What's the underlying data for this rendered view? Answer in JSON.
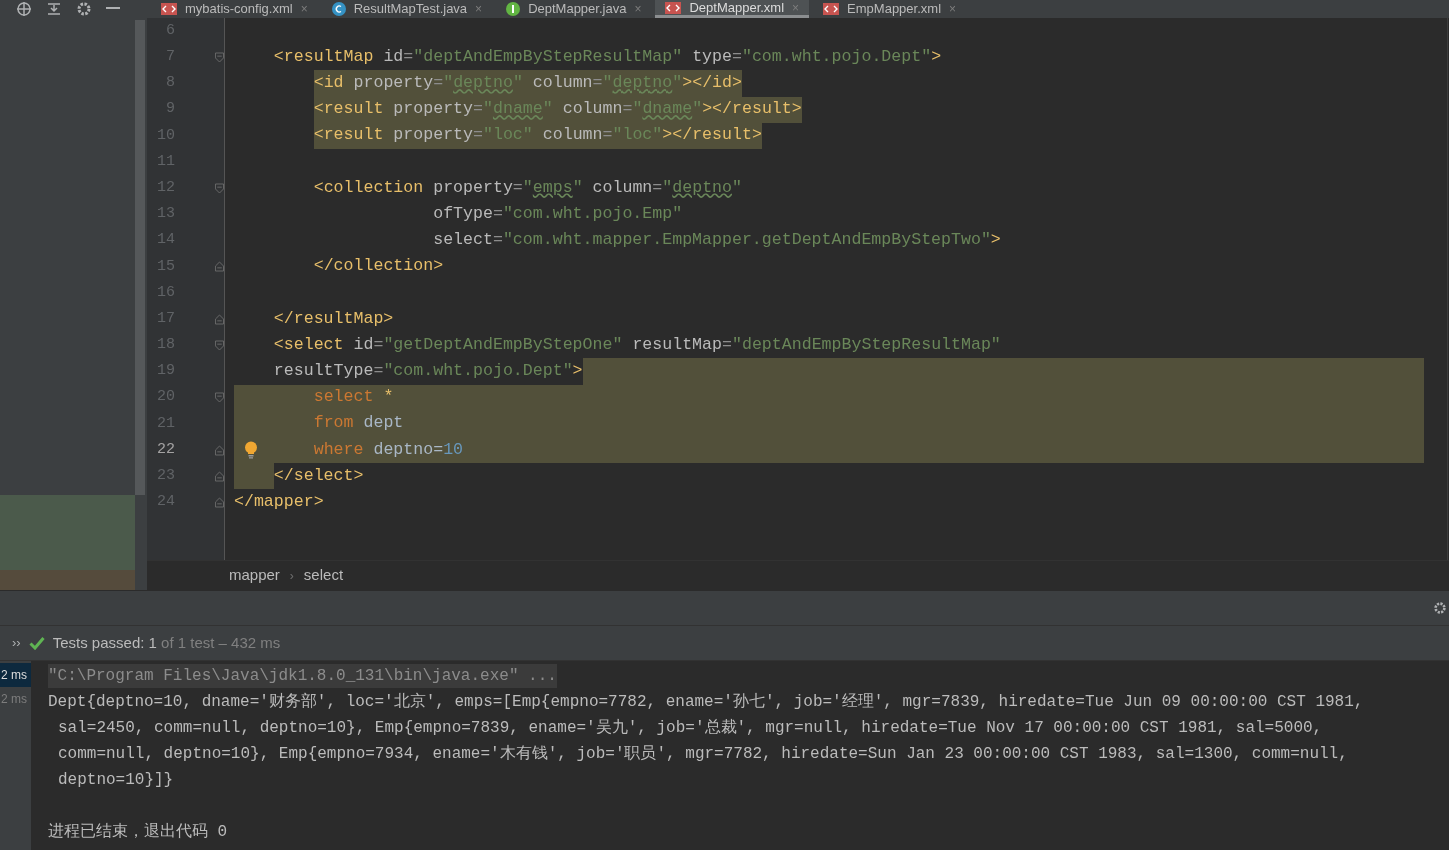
{
  "tabs": [
    {
      "label": "mybatis-config.xml",
      "kind": "xml",
      "selected": false,
      "close": "×"
    },
    {
      "label": "ResultMapTest.java",
      "kind": "class",
      "selected": false,
      "close": "×"
    },
    {
      "label": "DeptMapper.java",
      "kind": "interface",
      "selected": false,
      "close": "×"
    },
    {
      "label": "DeptMapper.xml",
      "kind": "xml",
      "selected": true,
      "close": "×"
    },
    {
      "label": "EmpMapper.xml",
      "kind": "xml",
      "selected": false,
      "close": "×"
    }
  ],
  "editor": {
    "lines": [
      {
        "number": "6",
        "kind": "line",
        "fold_start": false,
        "fold_end": false,
        "selected": false,
        "selection_head": false,
        "selection_tail": false,
        "current": false,
        "bulb": false
      },
      {
        "number": "7",
        "kind": "line",
        "fold_start": true,
        "fold_end": false,
        "highlighted": false,
        "selected": false,
        "selection_head": false,
        "selection_tail": false,
        "current": false,
        "bulb": false,
        "tokens": [
          {
            "kind": "tag",
            "t": "<resultMap"
          },
          {
            "kind": "attr",
            "t": "id"
          },
          {
            "kind": "eq",
            "t": "="
          },
          {
            "kind": "value",
            "t": "\"deptAndEmpByStepResultMap\""
          },
          {
            "kind": "attr",
            "t": "type"
          },
          {
            "kind": "eq",
            "t": "="
          },
          {
            "kind": "value",
            "t": "\"com.wht.pojo.Dept\""
          },
          {
            "kind": "tag",
            "t": ">"
          }
        ],
        "children": [
          {
            "number": "8",
            "kind": "line",
            "fold_start": false,
            "fold_end": false,
            "highlighted": true,
            "selected": false,
            "selection_head": false,
            "selection_tail": false,
            "current": false,
            "bulb": false,
            "tokens": [
              {
                "kind": "tag",
                "t": "<id"
              },
              {
                "kind": "attr",
                "t": "property"
              },
              {
                "kind": "eq",
                "t": "="
              },
              {
                "kind": "quote",
                "t": "\""
              },
              {
                "kind": "typo",
                "t": "deptno"
              },
              {
                "kind": "quote",
                "t": "\""
              },
              {
                "kind": "attr",
                "t": "column"
              },
              {
                "kind": "eq",
                "t": "="
              },
              {
                "kind": "quote",
                "t": "\""
              },
              {
                "kind": "typo",
                "t": "deptno"
              },
              {
                "kind": "quote",
                "t": "\""
              },
              {
                "kind": "tag",
                "t": "></id>"
              }
            ]
          },
          {
            "number": "9",
            "kind": "line",
            "fold_start": false,
            "fold_end": false,
            "highlighted": true,
            "selected": false,
            "selection_head": false,
            "selection_tail": false,
            "current": false,
            "bulb": false,
            "tokens": [
              {
                "kind": "tag",
                "t": "<result"
              },
              {
                "kind": "attr",
                "t": "property"
              },
              {
                "kind": "eq",
                "t": "="
              },
              {
                "kind": "quote",
                "t": "\""
              },
              {
                "kind": "typo",
                "t": "dname"
              },
              {
                "kind": "quote",
                "t": "\""
              },
              {
                "kind": "attr",
                "t": "column"
              },
              {
                "kind": "eq",
                "t": "="
              },
              {
                "kind": "quote",
                "t": "\""
              },
              {
                "kind": "typo",
                "t": "dname"
              },
              {
                "kind": "quote",
                "t": "\""
              },
              {
                "kind": "tag",
                "t": "></result>"
              }
            ]
          },
          {
            "number": "10",
            "kind": "line",
            "fold_start": false,
            "fold_end": false,
            "highlighted": true,
            "selected": false,
            "selection_head": false,
            "selection_tail": false,
            "current": false,
            "bulb": false,
            "tokens": [
              {
                "kind": "tag",
                "t": "<result"
              },
              {
                "kind": "attr",
                "t": "property"
              },
              {
                "kind": "eq",
                "t": "="
              },
              {
                "kind": "quote",
                "t": "\"loc\""
              },
              {
                "kind": "attr",
                "t": "column"
              },
              {
                "kind": "eq",
                "t": "="
              },
              {
                "kind": "quote",
                "t": "\"loc\""
              },
              {
                "kind": "tag",
                "t": "></result>"
              }
            ]
          },
          {
            "number": "11",
            "kind": "line",
            "fold_start": false,
            "fold_end": false,
            "selected": false,
            "selection_head": false,
            "selection_tail": false,
            "current": false,
            "bulb": false
          },
          {
            "number": "12",
            "kind": "line",
            "fold_start": true,
            "fold_end": false,
            "highlighted": false,
            "selected": false,
            "selection_head": false,
            "selection_tail": false,
            "current": false,
            "bulb": false,
            "tokens": [
              {
                "kind": "tag",
                "t": "<collection"
              },
              {
                "kind": "attr",
                "t": "property"
              },
              {
                "kind": "eq",
                "t": "="
              },
              {
                "kind": "value",
                "t": "\""
              },
              {
                "kind": "typo",
                "t": "emps"
              },
              {
                "kind": "value",
                "t": "\""
              },
              {
                "kind": "attr",
                "t": "column"
              },
              {
                "kind": "eq",
                "t": "="
              },
              {
                "kind": "value",
                "t": "\""
              },
              {
                "kind": "typo",
                "t": "deptno"
              },
              {
                "kind": "value",
                "t": "\""
              }
            ],
            "children": [
              {
                "number": "13",
                "kind": "continuation",
                "fold_start": false,
                "fold_end": false,
                "highlighted": false,
                "selected": false,
                "selection_head": false,
                "selection_tail": false,
                "current": false,
                "bulb": false,
                "tokens": [
                  {
                    "kind": "attr",
                    "t": "ofType"
                  },
                  {
                    "kind": "eq",
                    "t": "="
                  },
                  {
                    "kind": "value",
                    "t": "\"com.wht.pojo.Emp\""
                  }
                ]
              },
              {
                "number": "14",
                "kind": "continuation",
                "fold_start": false,
                "fold_end": false,
                "highlighted": false,
                "selected": false,
                "selection_head": false,
                "selection_tail": false,
                "current": false,
                "bulb": false,
                "tokens": [
                  {
                    "kind": "attr",
                    "t": "select"
                  },
                  {
                    "kind": "eq",
                    "t": "="
                  },
                  {
                    "kind": "value",
                    "t": "\"com.wht.mapper.EmpMapper.getDeptAndEmpByStepTwo\""
                  },
                  {
                    "kind": "tag",
                    "t": ">"
                  }
                ]
              }
            ]
          },
          {
            "number": "15",
            "kind": "line",
            "fold_start": false,
            "fold_end": true,
            "highlighted": false,
            "selected": false,
            "selection_head": false,
            "selection_tail": false,
            "current": false,
            "bulb": false,
            "tokens": [
              {
                "kind": "tag",
                "t": "</collection>"
              }
            ]
          },
          {
            "number": "16",
            "kind": "line",
            "fold_start": false,
            "fold_end": false,
            "selected": false,
            "selection_head": false,
            "selection_tail": false,
            "current": false,
            "bulb": false
          }
        ]
      },
      {
        "number": "17",
        "kind": "line",
        "fold_start": false,
        "fold_end": true,
        "highlighted": false,
        "selected": false,
        "selection_head": false,
        "selection_tail": false,
        "current": false,
        "bulb": false,
        "tokens": [
          {
            "kind": "tag",
            "t": "</resultMap>"
          }
        ]
      },
      {
        "number": "18",
        "kind": "line",
        "fold_start": true,
        "fold_end": false,
        "highlighted": false,
        "selected": false,
        "selection_head": false,
        "selection_tail": false,
        "current": false,
        "bulb": false,
        "tokens": [
          {
            "kind": "tag",
            "t": "<select"
          },
          {
            "kind": "attr",
            "t": "id"
          },
          {
            "kind": "eq",
            "t": "="
          },
          {
            "kind": "value",
            "t": "\"getDeptAndEmpByStepOne\""
          },
          {
            "kind": "attr",
            "t": "resultMap"
          },
          {
            "kind": "eq",
            "t": "="
          },
          {
            "kind": "value",
            "t": "\"deptAndEmpByStepResultMap\""
          }
        ],
        "children": [
          {
            "number": "19",
            "kind": "wrapped",
            "fold_start": false,
            "fold_end": false,
            "highlighted": false,
            "selected": false,
            "selection_head": false,
            "selection_tail": true,
            "current": false,
            "bulb": false,
            "tokens": [
              {
                "kind": "attr",
                "t": "resultType"
              },
              {
                "kind": "eq",
                "t": "="
              },
              {
                "kind": "value",
                "t": "\"com.wht.pojo.Dept\""
              },
              {
                "kind": "tag",
                "t": ">"
              }
            ]
          },
          {
            "number": "20",
            "kind": "line",
            "fold_start": true,
            "fold_end": false,
            "highlighted": false,
            "selected": true,
            "selection_head": false,
            "selection_tail": false,
            "current": false,
            "bulb": false,
            "tokens": [
              {
                "kind": "keyword",
                "t": "select"
              },
              {
                "kind": "star",
                "t": "*"
              }
            ]
          },
          {
            "number": "21",
            "kind": "line",
            "fold_start": false,
            "fold_end": false,
            "highlighted": false,
            "selected": true,
            "selection_head": false,
            "selection_tail": false,
            "current": false,
            "bulb": false,
            "tokens": [
              {
                "kind": "keyword",
                "t": "from"
              },
              {
                "kind": "ident",
                "t": "dept"
              }
            ]
          },
          {
            "number": "22",
            "kind": "line",
            "fold_start": false,
            "fold_end": true,
            "highlighted": false,
            "selected": true,
            "selection_head": false,
            "selection_tail": false,
            "current": true,
            "bulb": true,
            "tokens": [
              {
                "kind": "keyword",
                "t": "where"
              },
              {
                "kind": "ident",
                "t": "deptno="
              },
              {
                "kind": "number",
                "t": "10"
              }
            ]
          }
        ]
      },
      {
        "number": "23",
        "kind": "line",
        "fold_start": false,
        "fold_end": true,
        "highlighted": false,
        "selected": false,
        "selection_head": true,
        "selection_tail": false,
        "current": false,
        "bulb": false,
        "tokens": [
          {
            "kind": "tag",
            "t": "</select>"
          }
        ]
      },
      {
        "number": "24",
        "kind": "outer",
        "fold_start": false,
        "fold_end": true,
        "highlighted": false,
        "selected": false,
        "selection_head": false,
        "selection_tail": false,
        "current": false,
        "bulb": false,
        "tokens": [
          {
            "kind": "tag",
            "t": "</mapper>"
          }
        ]
      }
    ]
  },
  "breadcrumbs": {
    "items": [
      "mapper",
      "select"
    ],
    "separator": "›"
  },
  "test_bar": {
    "expander": "››",
    "status": "Tests passed:",
    "count": "1",
    "detail": "of 1 test – 432 ms"
  },
  "console": {
    "timings": [
      {
        "label": "2 ms",
        "selected": true
      },
      {
        "label": "2 ms",
        "selected": false
      }
    ],
    "command": "\"C:\\Program Files\\Java\\jdk1.8.0_131\\bin\\java.exe\" ...",
    "output": [
      "Dept{deptno=10, dname='财务部', loc='北京', emps=[Emp{empno=7782, ename='孙七', job='经理', mgr=7839, hiredate=Tue Jun 09 00:00:00 CST 1981,",
      "sal=2450, comm=null, deptno=10}, Emp{empno=7839, ename='吴九', job='总裁', mgr=null, hiredate=Tue Nov 17 00:00:00 CST 1981, sal=5000,",
      "comm=null, deptno=10}, Emp{empno=7934, ename='木有钱', job='职员', mgr=7782, hiredate=Sun Jan 23 00:00:00 CST 1983, sal=1300, comm=null,",
      "deptno=10}]}"
    ],
    "exit": "进程已结束，退出代码 0"
  }
}
